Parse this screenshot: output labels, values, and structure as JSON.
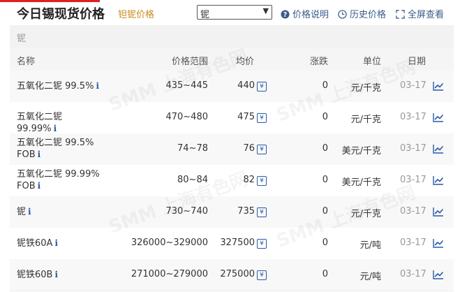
{
  "header": {
    "title": "今日锡现货价格",
    "subtitle": "钽铌价格",
    "select_value": "铌",
    "links": {
      "price_desc": "价格说明",
      "history": "历史价格",
      "fullscreen": "全屏查看"
    }
  },
  "filter": {
    "label": "铌"
  },
  "table": {
    "columns": {
      "name": "名称",
      "range": "价格范围",
      "avg": "均价",
      "change": "涨跌",
      "unit": "单位",
      "date": "日期"
    },
    "rows": [
      {
        "name": "五氧化二铌 99.5%",
        "range": "435~445",
        "avg": "440",
        "change": "0",
        "unit": "元/千克",
        "date": "03-17"
      },
      {
        "name": "五氧化二铌 99.99%",
        "range": "470~480",
        "avg": "475",
        "change": "0",
        "unit": "元/千克",
        "date": "03-17"
      },
      {
        "name": "五氧化二铌 99.5% FOB",
        "range": "74~78",
        "avg": "76",
        "change": "0",
        "unit": "美元/千克",
        "date": "03-17"
      },
      {
        "name": "五氧化二铌 99.99% FOB",
        "range": "80~84",
        "avg": "82",
        "change": "0",
        "unit": "美元/千克",
        "date": "03-17"
      },
      {
        "name": "铌",
        "range": "730~740",
        "avg": "735",
        "change": "0",
        "unit": "元/千克",
        "date": "03-17"
      },
      {
        "name": "铌铁60A",
        "range": "326000~329000",
        "avg": "327500",
        "change": "0",
        "unit": "元/吨",
        "date": "03-17"
      },
      {
        "name": "铌铁60B",
        "range": "271000~279000",
        "avg": "275000",
        "change": "0",
        "unit": "元/吨",
        "date": "03-17"
      }
    ]
  },
  "watermark": "SMM 上海有色网",
  "colors": {
    "accent": "#e02020",
    "link": "#3b5a8a",
    "icon": "#2a5aa6",
    "subtitle": "#c98a1c"
  }
}
